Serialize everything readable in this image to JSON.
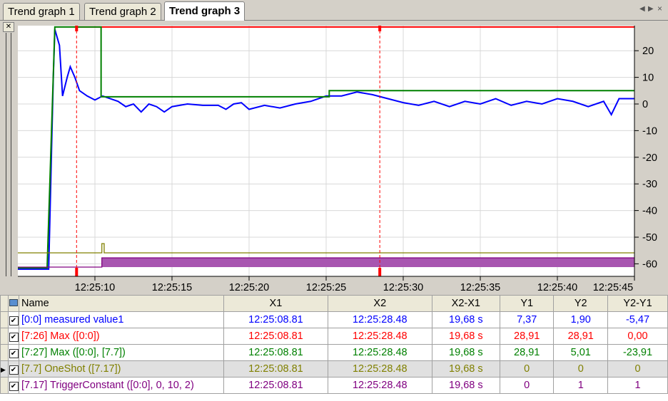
{
  "tabs": [
    {
      "label": "Trend graph 1"
    },
    {
      "label": "Trend graph 2"
    },
    {
      "label": "Trend graph 3",
      "active": true
    }
  ],
  "chart_data": {
    "type": "line",
    "x_unit": "seconds after 12:25:05",
    "xlim": [
      0,
      40
    ],
    "ylim": [
      -64,
      30
    ],
    "x_tick_labels": [
      "12:25:10",
      "12:25:15",
      "12:25:20",
      "12:25:25",
      "12:25:30",
      "12:25:35",
      "12:25:40",
      "12:25:45"
    ],
    "x_ticks": [
      5,
      10,
      15,
      20,
      25,
      30,
      35,
      40
    ],
    "y_ticks": [
      20,
      10,
      0,
      -10,
      -20,
      -30,
      -40,
      -50,
      -60
    ],
    "cursors": {
      "x1": 3.81,
      "x2": 23.48
    },
    "series": [
      {
        "name": "[0:0] measured value1",
        "color": "#0000ff",
        "points": [
          [
            0,
            -62
          ],
          [
            2,
            -62
          ],
          [
            2.3,
            10
          ],
          [
            2.4,
            28
          ],
          [
            2.7,
            22
          ],
          [
            2.9,
            3
          ],
          [
            3.2,
            10
          ],
          [
            3.4,
            14
          ],
          [
            3.7,
            10
          ],
          [
            4,
            5
          ],
          [
            4.5,
            3
          ],
          [
            5,
            1.5
          ],
          [
            5.5,
            3
          ],
          [
            6,
            2
          ],
          [
            6.5,
            1
          ],
          [
            7,
            -1
          ],
          [
            7.5,
            0
          ],
          [
            8,
            -3
          ],
          [
            8.5,
            0
          ],
          [
            9,
            -1
          ],
          [
            9.5,
            -3
          ],
          [
            10,
            -1
          ],
          [
            11,
            0
          ],
          [
            12,
            -0.5
          ],
          [
            13,
            -0.5
          ],
          [
            13.5,
            -2
          ],
          [
            14,
            0
          ],
          [
            14.5,
            0.5
          ],
          [
            15,
            -2
          ],
          [
            16,
            -0.5
          ],
          [
            17,
            -1.5
          ],
          [
            18,
            0
          ],
          [
            19,
            1
          ],
          [
            20,
            3
          ],
          [
            21,
            3
          ],
          [
            22,
            4.5
          ],
          [
            23,
            3.5
          ],
          [
            24,
            2
          ],
          [
            25,
            0.5
          ],
          [
            26,
            -0.5
          ],
          [
            27,
            1
          ],
          [
            28,
            -1
          ],
          [
            29,
            1
          ],
          [
            30,
            0
          ],
          [
            31,
            2
          ],
          [
            32,
            -0.5
          ],
          [
            33,
            1
          ],
          [
            34,
            0
          ],
          [
            35,
            2
          ],
          [
            36,
            1
          ],
          [
            37,
            -1
          ],
          [
            38,
            1
          ],
          [
            38.5,
            -4
          ],
          [
            39,
            2
          ],
          [
            40,
            2
          ]
        ]
      },
      {
        "name": "[7:26] Max ([0:0])",
        "color": "#ff0000",
        "points": [
          [
            3.81,
            28.91
          ],
          [
            40,
            28.91
          ]
        ]
      },
      {
        "name": "[7:27] Max ([0:0], [7.7])",
        "color": "#008000",
        "points": [
          [
            0,
            -61.5
          ],
          [
            1.9,
            -61.5
          ],
          [
            2.4,
            28.91
          ],
          [
            5.4,
            28.91
          ],
          [
            5.4,
            2.7
          ],
          [
            20.2,
            2.7
          ],
          [
            20.2,
            5.01
          ],
          [
            40,
            5.01
          ]
        ]
      },
      {
        "name": "[7.7] OneShot ([7.17])",
        "color": "#808000",
        "points": [
          [
            0,
            0
          ],
          [
            5.45,
            0
          ],
          [
            5.45,
            1
          ],
          [
            5.6,
            1
          ],
          [
            5.6,
            0
          ],
          [
            40,
            0
          ]
        ]
      },
      {
        "name": "[7.17] TriggerConstant ([0:0], 0, 10, 2)",
        "color": "#800080",
        "points": [
          [
            0,
            0
          ],
          [
            5.45,
            0
          ],
          [
            5.45,
            1
          ],
          [
            40,
            1
          ]
        ]
      }
    ]
  },
  "table": {
    "headers": [
      "Name",
      "X1",
      "X2",
      "X2-X1",
      "Y1",
      "Y2",
      "Y2-Y1"
    ],
    "rows": [
      {
        "color": "#0000ff",
        "cells": [
          "[0:0] measured value1",
          "12:25:08.81",
          "12:25:28.48",
          "19,68 s",
          "7,37",
          "1,90",
          "-5,47"
        ]
      },
      {
        "color": "#ff0000",
        "cells": [
          "[7:26] Max ([0:0])",
          "12:25:08.81",
          "12:25:28.48",
          "19,68 s",
          "28,91",
          "28,91",
          "0,00"
        ]
      },
      {
        "color": "#008000",
        "cells": [
          "[7:27] Max ([0:0], [7.7])",
          "12:25:08.81",
          "12:25:28.48",
          "19,68 s",
          "28,91",
          "5,01",
          "-23,91"
        ]
      },
      {
        "color": "#808000",
        "cells": [
          "[7.7] OneShot ([7.17])",
          "12:25:08.81",
          "12:25:28.48",
          "19,68 s",
          "0",
          "0",
          "0"
        ],
        "selected": true
      },
      {
        "color": "#800080",
        "cells": [
          "[7.17] TriggerConstant ([0:0], 0, 10, 2)",
          "12:25:08.81",
          "12:25:28.48",
          "19,68 s",
          "0",
          "1",
          "1"
        ]
      }
    ]
  }
}
